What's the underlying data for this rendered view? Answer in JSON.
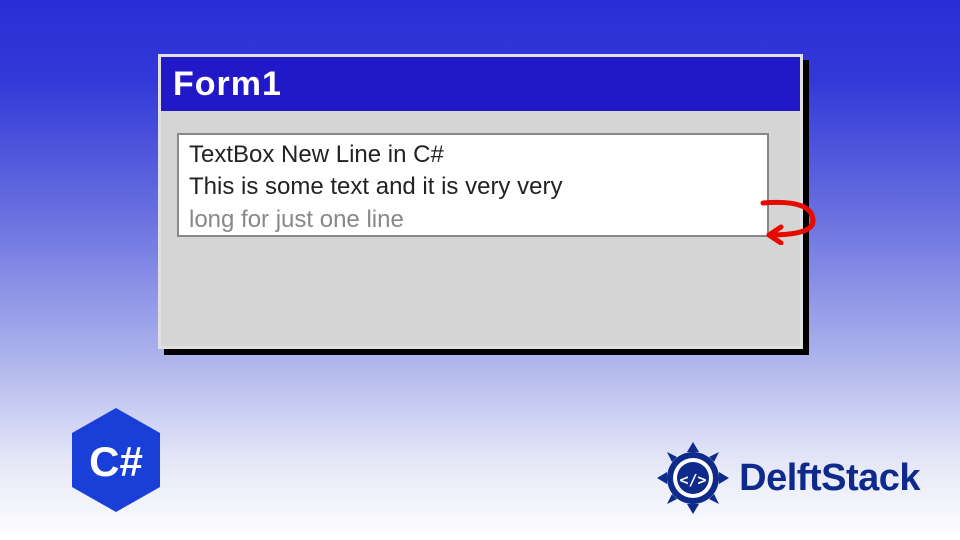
{
  "window": {
    "title": "Form1"
  },
  "textbox": {
    "line1": "TextBox New Line in C#",
    "line2": "This is some text and it is very very",
    "line3_partial": "long for just one line"
  },
  "badges": {
    "csharp_label": "C#",
    "brand_name": "DelftStack",
    "brand_icon_glyph": "</>"
  },
  "annotation": {
    "arrow_name": "wrap-arrow"
  },
  "colors": {
    "titlebar": "#2118c8",
    "badge": "#1a3fd9",
    "brand": "#0e2a8a",
    "arrow": "#e60b00"
  }
}
